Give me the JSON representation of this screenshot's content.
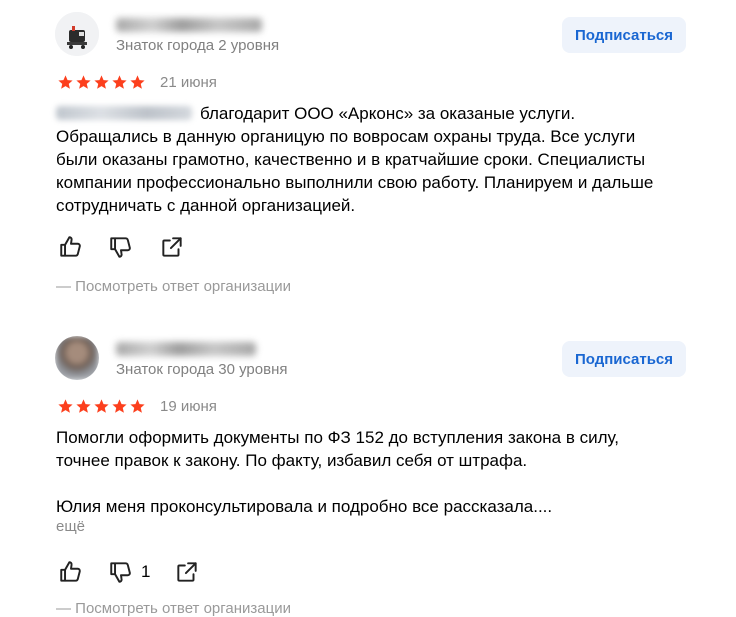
{
  "reviews": [
    {
      "author_level": "Знаток города 2 уровня",
      "subscribe_label": "Подписаться",
      "rating": 5,
      "date": "21 июня",
      "text": "благодарит ООО «Арконс» за оказаные услуги.\nОбращались в данную органицую по вовросам охраны труда. Все услуги были оказаны грамотно, качественно и в кратчайшие сроки. Специалисты компании профессионально выполнили свою работу. Планируем и дальше сотрудничать с данной организацией.",
      "dislike_count": "",
      "org_reply_label": "— Посмотреть ответ организации"
    },
    {
      "author_level": "Знаток города 30 уровня",
      "subscribe_label": "Подписаться",
      "rating": 5,
      "date": "19 июня",
      "text": "Помогли оформить документы по ФЗ 152 до вступления закона в силу, точнее правок к закону. По факту, избавил себя от штрафа.\n\nЮлия меня проконсультировала и подробно все рассказала....",
      "more_label": "ещё",
      "dislike_count": "1",
      "org_reply_label": "— Посмотреть ответ организации"
    }
  ],
  "colors": {
    "star": "#fc3f1d",
    "star_fill": "#ffcc00",
    "link": "#1a67d2",
    "muted": "#808080"
  }
}
